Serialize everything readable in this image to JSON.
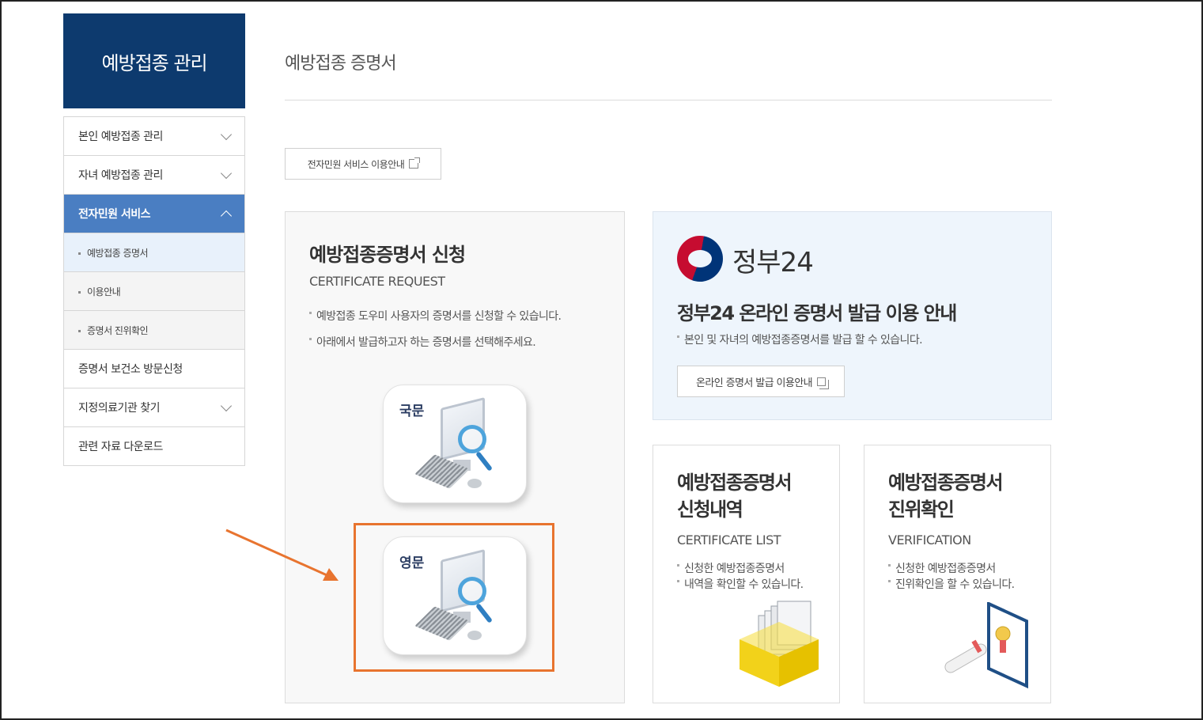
{
  "sidebar": {
    "title": "예방접종 관리",
    "items": [
      {
        "label": "본인 예방접종 관리"
      },
      {
        "label": "자녀 예방접종 관리"
      },
      {
        "label": "전자민원 서비스"
      },
      {
        "label": "예방접종 증명서"
      },
      {
        "label": "이용안내"
      },
      {
        "label": "증명서 진위확인"
      },
      {
        "label": "증명서 보건소 방문신청"
      },
      {
        "label": "지정의료기관 찾기"
      },
      {
        "label": "관련 자료 다운로드"
      }
    ]
  },
  "page": {
    "title": "예방접종 증명서",
    "guide_button": "전자민원 서비스 이용안내"
  },
  "request_card": {
    "title": "예방접종증명서 신청",
    "subtitle": "CERTIFICATE REQUEST",
    "bullets": [
      "예방접종 도우미 사용자의 증명서를 신청할 수 있습니다.",
      "아래에서 발급하고자 하는 증명서를 선택해주세요."
    ],
    "korean_label": "국문",
    "english_label": "영문"
  },
  "gov_card": {
    "brand": "정부24",
    "title": "정부24 온라인 증명서 발급 이용 안내",
    "desc": "본인 및 자녀의 예방접종증명서를 발급 할 수 있습니다.",
    "button": "온라인 증명서 발급 이용안내"
  },
  "list_card": {
    "title_line1": "예방접종증명서",
    "title_line2": "신청내역",
    "subtitle": "CERTIFICATE LIST",
    "desc_line1": "신청한 예방접종증명서",
    "desc_line2": "내역을 확인할 수 있습니다."
  },
  "verify_card": {
    "title_line1": "예방접종증명서",
    "title_line2": "진위확인",
    "subtitle": "VERIFICATION",
    "desc_line1": "신청한 예방접종증명서",
    "desc_line2": "진위확인을 할 수 있습니다."
  },
  "colors": {
    "sidebar_header": "#0d3a6e",
    "active_menu": "#4a7ec2",
    "highlight": "#e8742f"
  }
}
